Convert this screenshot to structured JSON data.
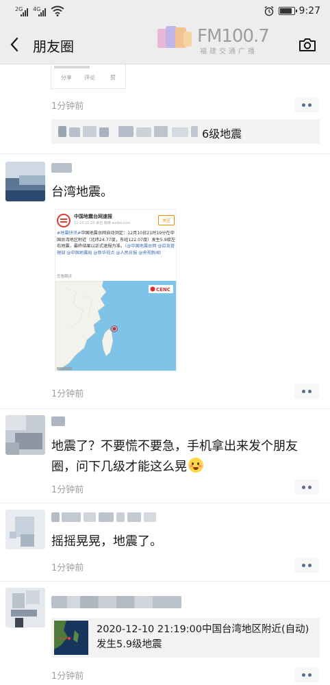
{
  "status_bar": {
    "signal1_label": "2G",
    "signal2_label": "4G",
    "time": "9:27",
    "icons": [
      "signal-icon",
      "wifi-icon",
      "alarm-icon",
      "battery-icon"
    ]
  },
  "nav": {
    "title": "朋友圈",
    "back_icon": "chevron-left-icon",
    "camera_icon": "camera-icon"
  },
  "watermark": {
    "brand": "FM100.7",
    "subtitle": "福建交通广播"
  },
  "top_card": {
    "labels": [
      "分享",
      "评论",
      "赞"
    ]
  },
  "posts": [
    {
      "time": "1分钟前",
      "share_text": "6级地震"
    },
    {
      "text": "台湾地震。",
      "time": "1分钟前",
      "image": {
        "account": "中国地震台网速报",
        "meta": "12-10 21:20 来自 微博 weibo.com",
        "follow": "关注",
        "body_tag": "#地震快讯#",
        "body": "中国地震台网自动测定：12月10日21时19分在中国台湾地区附近（北纬24.77度，东经122.07度）发生5.9级左右地震，最终结果以正式速报为准。",
        "body_mentions": "（@中国地震台网 @应急管理部 @中国地震局 @新华视点 @人民日报 @央视新闻）",
        "source": "查看翻译",
        "badge": "CENC"
      }
    },
    {
      "text": "地震了？不要慌不要急，手机拿出来发个朋友圈，问下几级才能这么晃",
      "time": "1分钟前",
      "emoji": "flushed-face-emoji"
    },
    {
      "text": "摇摇晃晃，地震了。",
      "time": "1分钟前"
    },
    {
      "link_text": "2020-12-10 21:19:00中国台湾地区附近(自动)发生5.9级地震",
      "time": "1分钟前"
    }
  ],
  "colors": {
    "link_blue": "#576b95",
    "time_gray": "#a0a0a0",
    "bar_bg": "#ededed",
    "share_bg": "#f3f3f3"
  }
}
